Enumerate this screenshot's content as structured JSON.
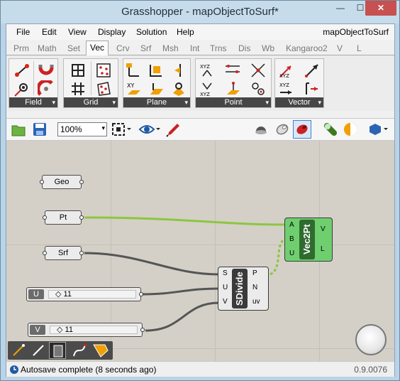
{
  "window": {
    "title": "Grasshopper - mapObjectToSurf*",
    "min_glyph": "—",
    "max_glyph": "☐",
    "close_glyph": "✕"
  },
  "menu": {
    "items": [
      "File",
      "Edit",
      "View",
      "Display",
      "Solution",
      "Help"
    ],
    "document_name": "mapObjectToSurf"
  },
  "tabs": {
    "items": [
      "Prm",
      "Math",
      "Set",
      "Vec",
      "Crv",
      "Srf",
      "Msh",
      "Int",
      "Trns",
      "Dis",
      "Wb",
      "Kangaroo2",
      "V",
      "L"
    ],
    "active": "Vec"
  },
  "panels": [
    {
      "label": "Field",
      "expand": "▾"
    },
    {
      "label": "Grid",
      "expand": "▾"
    },
    {
      "label": "Plane",
      "expand": "▾"
    },
    {
      "label": "Point",
      "expand": "▾"
    },
    {
      "label": "Vector",
      "expand": "▾"
    }
  ],
  "panel_icon_text": {
    "xyz": "XYZ",
    "xy": "XY"
  },
  "canvas_toolbar": {
    "zoom": "100%",
    "zoom_dd": "▾"
  },
  "canvas": {
    "params": {
      "geo": "Geo",
      "pt": "Pt",
      "srf": "Srf"
    },
    "sliders": [
      {
        "name": "U",
        "value": "◇ 11"
      },
      {
        "name": "V",
        "value": "◇ 11"
      }
    ],
    "sdivide": {
      "name": "SDivide",
      "inputs": [
        "S",
        "U",
        "V"
      ],
      "outputs": [
        "P",
        "N",
        "uv"
      ]
    },
    "vec2pt": {
      "name": "Vec2Pt",
      "inputs": [
        "A",
        "B",
        "U"
      ],
      "outputs": [
        "V",
        "L"
      ]
    }
  },
  "colors": {
    "canvas": "#d4d0c8",
    "green_component": "#6fcf6f",
    "wire_selected": "#8cc63f",
    "wire_default": "#555555"
  },
  "status": {
    "message": "Autosave complete (8 seconds ago)",
    "version": "0.9.0076"
  }
}
